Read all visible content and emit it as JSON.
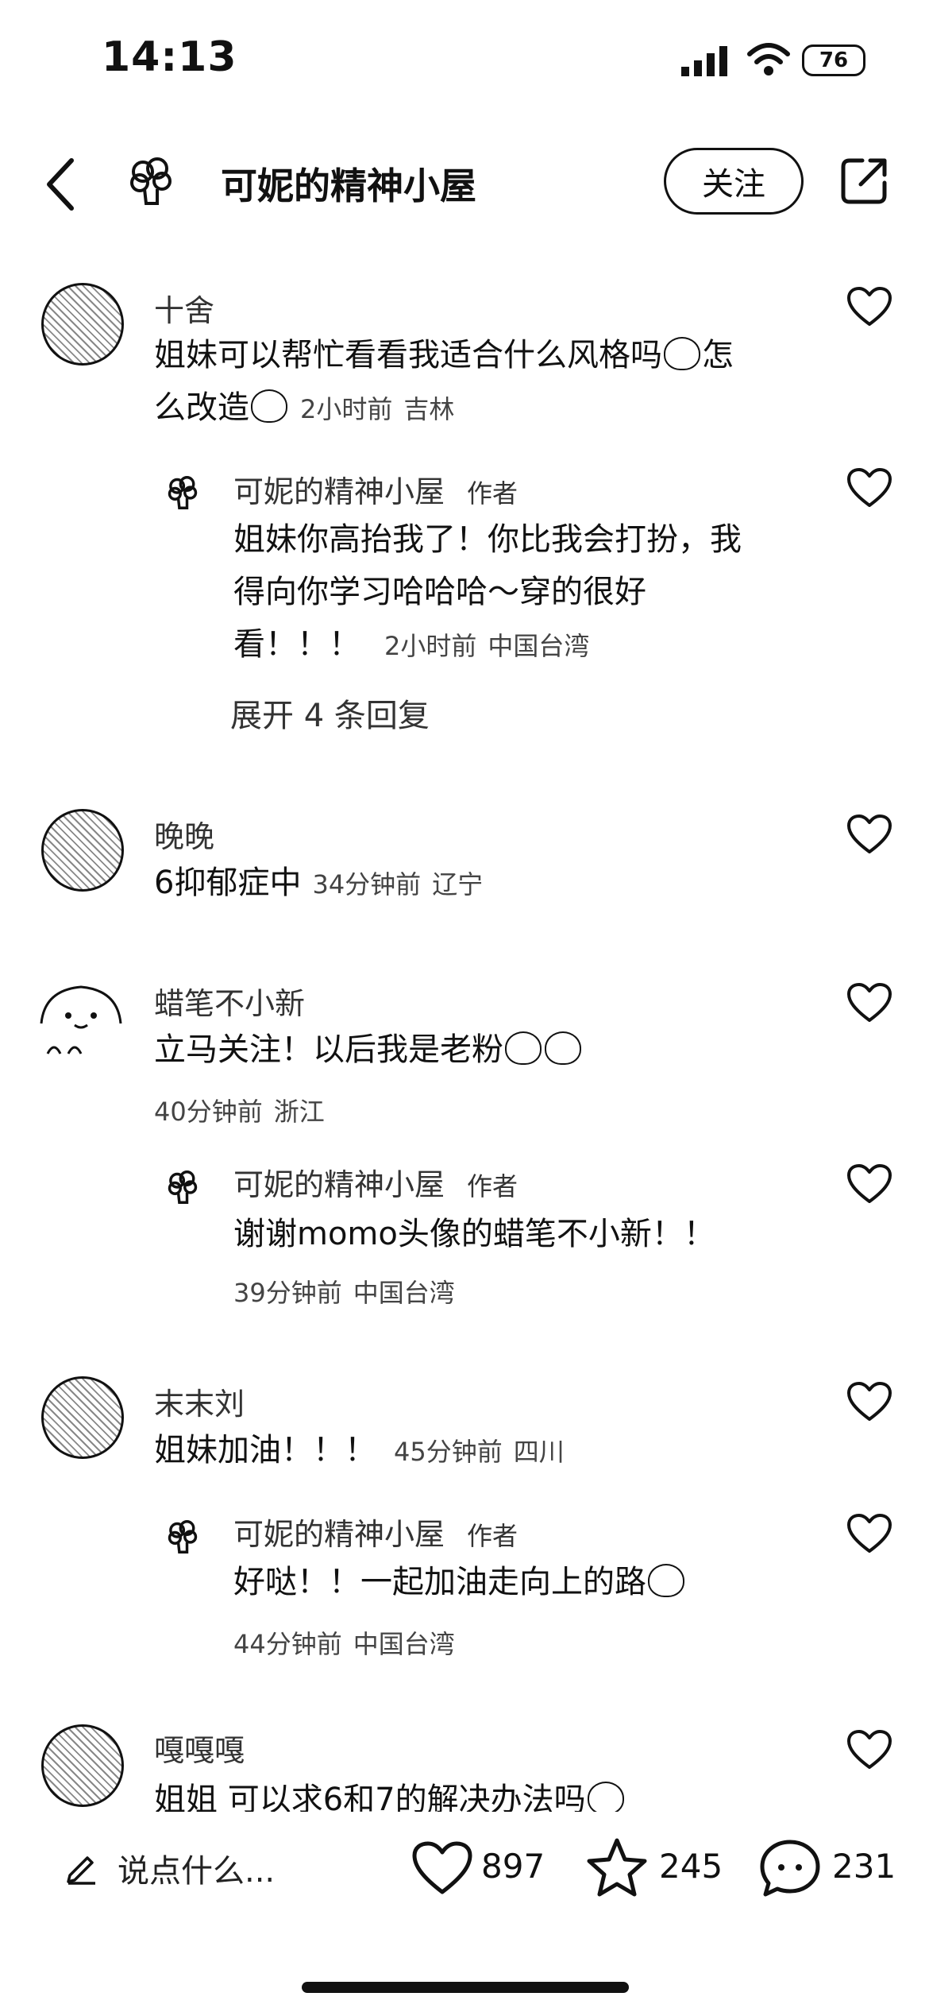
{
  "status_bar": {
    "time": "14:13",
    "battery": "76"
  },
  "header": {
    "title": "可妮的精神小屋",
    "follow_label": "关注"
  },
  "comments": [
    {
      "name": "十舍",
      "text_line1": "姐妹可以帮忙看看我适合什么风格吗",
      "text_line1_end": "怎",
      "text_line2": "么改造",
      "time": "2小时前",
      "location": "吉林",
      "reply": {
        "name": "可妮的精神小屋",
        "author_tag": "作者",
        "line1": "姐妹你高抬我了！你比我会打扮，我",
        "line2": "得向你学习哈哈哈～穿的很好",
        "line3": "看！！！",
        "time": "2小时前",
        "location": "中国台湾",
        "expand": "展开 4 条回复"
      }
    },
    {
      "name": "晚晚",
      "text": "6抑郁症中",
      "time": "34分钟前",
      "location": "辽宁"
    },
    {
      "name": "蜡笔不小新",
      "text": "立马关注！以后我是老粉",
      "time": "40分钟前",
      "location": "浙江",
      "reply": {
        "name": "可妮的精神小屋",
        "author_tag": "作者",
        "text": "谢谢momo头像的蜡笔不小新！！",
        "time": "39分钟前",
        "location": "中国台湾"
      }
    },
    {
      "name": "末末刘",
      "text": "姐妹加油！！！",
      "time": "45分钟前",
      "location": "四川",
      "reply": {
        "name": "可妮的精神小屋",
        "author_tag": "作者",
        "text": "好哒！！一起加油走向上的路",
        "time": "44分钟前",
        "location": "中国台湾"
      }
    },
    {
      "name": "嘎嘎嘎",
      "text": "姐姐 可以求6和7的解决办法吗"
    }
  ],
  "bottom_bar": {
    "placeholder": "说点什么...",
    "likes": "897",
    "stars": "245",
    "comments": "231"
  },
  "icons": {
    "back": "chevron-left-icon",
    "share": "share-icon",
    "heart": "heart-icon",
    "star": "star-icon",
    "chat": "chat-bubble-icon",
    "edit": "pencil-icon"
  }
}
